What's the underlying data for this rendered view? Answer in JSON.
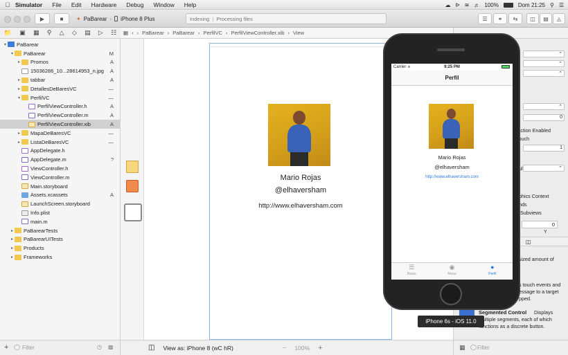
{
  "menubar": {
    "app_name": "Simulator",
    "items": [
      "File",
      "Edit",
      "Hardware",
      "Debug",
      "Window",
      "Help"
    ],
    "battery": "100%",
    "clock": "Dom 21:25"
  },
  "toolbar": {
    "scheme_project": "PaBarear",
    "scheme_device": "iPhone 8 Plus",
    "activity_status": "Indexing",
    "activity_detail": "Processing files"
  },
  "navigator": {
    "rows": [
      {
        "label": "PaBarear",
        "indent": 0,
        "icon": "proj",
        "tri": "▾",
        "status": "",
        "sel": false
      },
      {
        "label": "PaBarear",
        "indent": 1,
        "icon": "yfolder",
        "tri": "▾",
        "status": "M",
        "sel": false
      },
      {
        "label": "Promos",
        "indent": 2,
        "icon": "yfolder",
        "tri": "▸",
        "status": "A",
        "sel": false
      },
      {
        "label": "15036286_10...28614953_n.jpg",
        "indent": 2,
        "icon": "file",
        "tri": "",
        "status": "A",
        "sel": false
      },
      {
        "label": "tabbar",
        "indent": 2,
        "icon": "yfolder",
        "tri": "▸",
        "status": "A",
        "sel": false
      },
      {
        "label": "DetallesDeBaresVC",
        "indent": 2,
        "icon": "yfolder",
        "tri": "▸",
        "status": "—",
        "sel": false
      },
      {
        "label": "PerfilVC",
        "indent": 2,
        "icon": "yfolder",
        "tri": "▾",
        "status": "—",
        "sel": false
      },
      {
        "label": "PerfilViewController.h",
        "indent": 3,
        "icon": "h",
        "tri": "",
        "status": "A",
        "sel": false
      },
      {
        "label": "PerfilViewController.m",
        "indent": 3,
        "icon": "m",
        "tri": "",
        "status": "A",
        "sel": false
      },
      {
        "label": "PerfilViewController.xib",
        "indent": 3,
        "icon": "xib",
        "tri": "",
        "status": "A",
        "sel": true
      },
      {
        "label": "MapaDeBaresVC",
        "indent": 2,
        "icon": "yfolder",
        "tri": "▸",
        "status": "—",
        "sel": false
      },
      {
        "label": "ListaDeBaresVC",
        "indent": 2,
        "icon": "yfolder",
        "tri": "▸",
        "status": "—",
        "sel": false
      },
      {
        "label": "AppDelegate.h",
        "indent": 2,
        "icon": "h",
        "tri": "",
        "status": "",
        "sel": false
      },
      {
        "label": "AppDelegate.m",
        "indent": 2,
        "icon": "m",
        "tri": "",
        "status": "?",
        "sel": false
      },
      {
        "label": "ViewController.h",
        "indent": 2,
        "icon": "h",
        "tri": "",
        "status": "",
        "sel": false
      },
      {
        "label": "ViewController.m",
        "indent": 2,
        "icon": "m",
        "tri": "",
        "status": "",
        "sel": false
      },
      {
        "label": "Main.storyboard",
        "indent": 2,
        "icon": "sb",
        "tri": "",
        "status": "",
        "sel": false
      },
      {
        "label": "Assets.xcassets",
        "indent": 2,
        "icon": "assets",
        "tri": "",
        "status": "A",
        "sel": false
      },
      {
        "label": "LaunchScreen.storyboard",
        "indent": 2,
        "icon": "sb",
        "tri": "",
        "status": "",
        "sel": false
      },
      {
        "label": "Info.plist",
        "indent": 2,
        "icon": "plist",
        "tri": "",
        "status": "",
        "sel": false
      },
      {
        "label": "main.m",
        "indent": 2,
        "icon": "m",
        "tri": "",
        "status": "",
        "sel": false
      },
      {
        "label": "PaBarearTests",
        "indent": 1,
        "icon": "yfolder",
        "tri": "▸",
        "status": "",
        "sel": false
      },
      {
        "label": "PaBarearUITests",
        "indent": 1,
        "icon": "yfolder",
        "tri": "▸",
        "status": "",
        "sel": false
      },
      {
        "label": "Products",
        "indent": 1,
        "icon": "yfolder",
        "tri": "▸",
        "status": "",
        "sel": false
      },
      {
        "label": "Frameworks",
        "indent": 1,
        "icon": "yfolder",
        "tri": "▸",
        "status": "",
        "sel": false
      }
    ],
    "filter_placeholder": "Filter"
  },
  "jumpbar": {
    "crumbs": [
      "PaBarear",
      "PaBarear",
      "PerfilVC",
      "PerfilViewController.xib",
      "View"
    ]
  },
  "canvas": {
    "name": "Mario Rojas",
    "handle": "@elhaversham",
    "url": "http://www.elhaversham.com",
    "view_as": "View as: iPhone 8 (wC hR)",
    "zoom": "100%"
  },
  "simulator": {
    "carrier": "Carrier",
    "time": "9:25 PM",
    "nav_title": "Perfil",
    "name": "Mario Rojas",
    "handle": "@elhaversham",
    "url": "http://www.elhaversham.com",
    "tabs": [
      {
        "label": "Bares",
        "icon": "list-icon",
        "active": false
      },
      {
        "label": "Mosa",
        "icon": "map-pin-icon",
        "active": false
      },
      {
        "label": "Perfil",
        "icon": "person-icon",
        "active": true
      }
    ],
    "device_tooltip": "iPhone 6s - iOS 11.0"
  },
  "inspector": {
    "lines": [
      {
        "text": "",
        "popup": "⌃"
      },
      {
        "text": "",
        "popup": "⌃"
      },
      {
        "text": "",
        "popup": "⌃"
      },
      {
        "text": "",
        "popup": ""
      },
      {
        "text": "d",
        "popup": "⌃"
      },
      {
        "text": "",
        "popup": "0"
      },
      {
        "text": "raction Enabled",
        "popup": ""
      },
      {
        "text": "Touch",
        "popup": ""
      },
      {
        "text": "",
        "popup": "1"
      },
      {
        "text": "",
        "popup": ""
      },
      {
        "text": "ault",
        "popup": "⌃"
      },
      {
        "text": "aphics Context",
        "popup": ""
      },
      {
        "text": "unds",
        "popup": ""
      },
      {
        "text": "e Subviews",
        "popup": ""
      }
    ],
    "y_field": "0",
    "y_label": "Y",
    "lib_text1": "sized amount of",
    "lib_text2": "s touch events and",
    "lib_text3": "essage to a target",
    "lib_text4": "pped.",
    "seg_title": "Segmented Control",
    "seg_desc1": "Displays",
    "seg_desc2": "multiple segments, each of which",
    "seg_desc3": "functions as a discrete button.",
    "filter_placeholder": "Filter"
  }
}
